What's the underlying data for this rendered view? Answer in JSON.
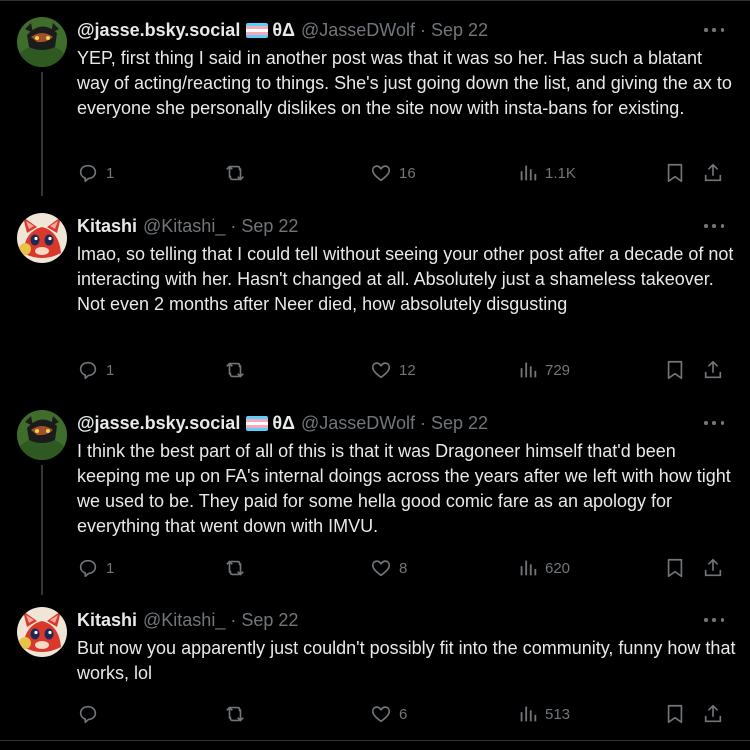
{
  "tweets": [
    {
      "name": "@jasse.bsky.social",
      "symbols": "θΔ",
      "handle": "@JasseDWolf",
      "separator": "·",
      "date": "Sep 22",
      "text": "YEP, first thing I said in another post was that it was so her. Has such a blatant way of acting/reacting to things. She's just going down the list, and giving the ax to everyone she personally dislikes on the site now with insta-bans for existing.",
      "replies": "1",
      "reposts": "",
      "likes": "16",
      "views": "1.1K"
    },
    {
      "name": "Kitashi",
      "symbols": "",
      "handle": "@Kitashi_",
      "separator": "·",
      "date": "Sep 22",
      "text": "lmao, so telling that I could tell without seeing your other post after a decade of not interacting with her.  Hasn't changed at all.  Absolutely just a shameless takeover.  Not even 2 months after Neer died, how absolutely disgusting",
      "replies": "1",
      "reposts": "",
      "likes": "12",
      "views": "729"
    },
    {
      "name": "@jasse.bsky.social",
      "symbols": "θΔ",
      "handle": "@JasseDWolf",
      "separator": "·",
      "date": "Sep 22",
      "text": "I think the best part of all of this is that it was Dragoneer himself that'd been keeping me up on FA's internal doings across the years after we left with how tight we used to be.  They paid for some hella good comic fare as an apology for everything that went down with IMVU.",
      "replies": "1",
      "reposts": "",
      "likes": "8",
      "views": "620"
    },
    {
      "name": "Kitashi",
      "symbols": "",
      "handle": "@Kitashi_",
      "separator": "·",
      "date": "Sep 22",
      "text": "But now you apparently just couldn't possibly fit into the community, funny how that works, lol",
      "replies": "",
      "reposts": "",
      "likes": "6",
      "views": "513"
    }
  ],
  "icons": {
    "reply": "reply-icon",
    "repost": "repost-icon",
    "like": "heart-icon",
    "views": "views-icon",
    "bookmark": "bookmark-icon",
    "share": "share-icon",
    "more": "more-icon",
    "flag": "trans-flag-icon"
  },
  "colors": {
    "background": "#000000",
    "text": "#e7e9ea",
    "muted": "#71767b",
    "divider": "#2f3336",
    "flag_blue": "#5bcefa",
    "flag_pink": "#f5a9b8",
    "flag_white": "#ffffff"
  }
}
